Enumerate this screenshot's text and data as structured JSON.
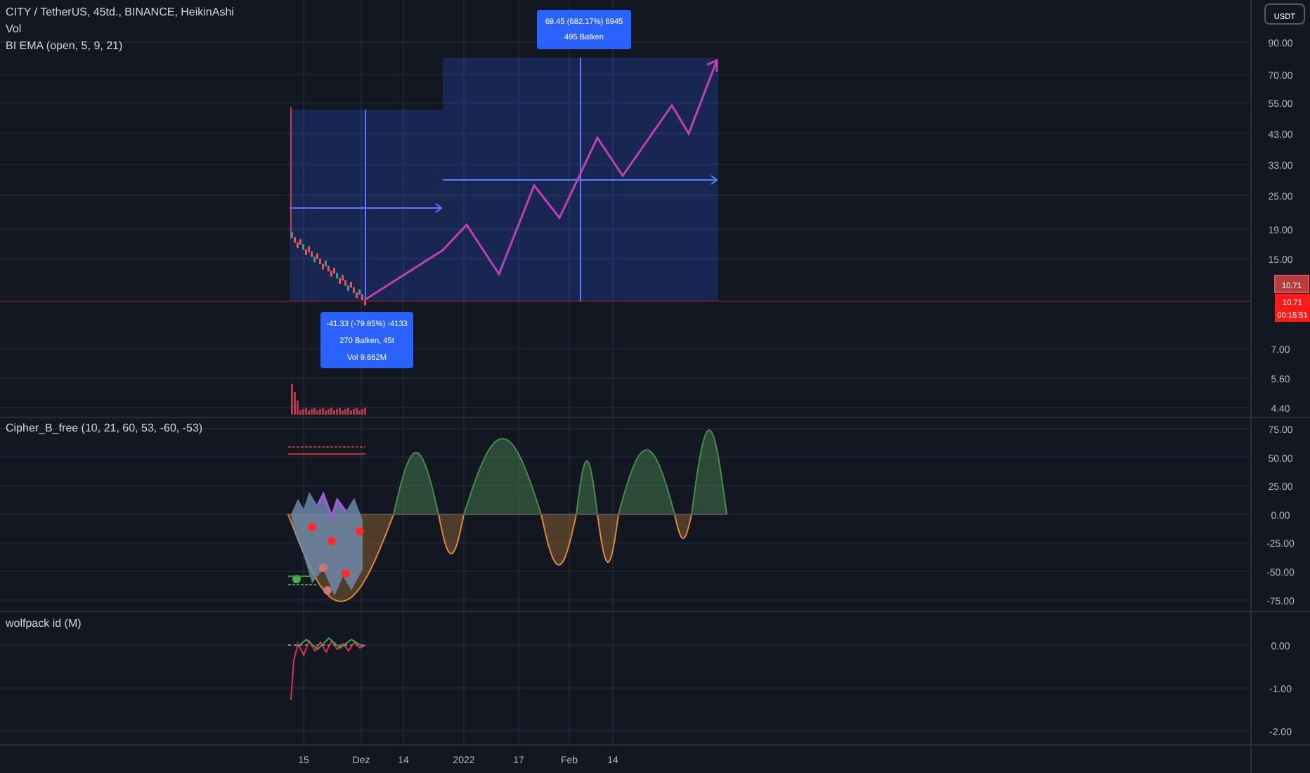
{
  "legend": [
    "CITY / TetherUS, 45td., BINANCE, HeikinAshi",
    "Vol",
    "BI EMA (open, 5, 9, 21)"
  ],
  "currency": "USDT",
  "price_axis": [
    "90.00",
    "70.00",
    "55.00",
    "43.00",
    "33.00",
    "25.00",
    "19.00",
    "15.00",
    "7.00",
    "5.60",
    "4.40"
  ],
  "last_price": {
    "prev": "10.71",
    "value": "10.71",
    "countdown": "00:15:51"
  },
  "measure_up": [
    "69.45 (682.17%) 6945",
    "495 Balken"
  ],
  "measure_down": [
    "-41.33 (-79.85%) -4133",
    "270 Balken, 45t",
    "Vol 9.662M"
  ],
  "cipher": {
    "title": "Cipher_B_free (10, 21, 60, 53, -60, -53)",
    "axis": [
      "75.00",
      "50.00",
      "25.00",
      "0.00",
      "-25.00",
      "-50.00",
      "-75.00"
    ]
  },
  "wolfpack": {
    "title": "wolfpack id (M)",
    "axis": [
      "0.00",
      "-1.00",
      "-2.00"
    ]
  },
  "time_axis": [
    "15",
    "Dez",
    "14",
    "2022",
    "17",
    "Feb",
    "14"
  ]
}
